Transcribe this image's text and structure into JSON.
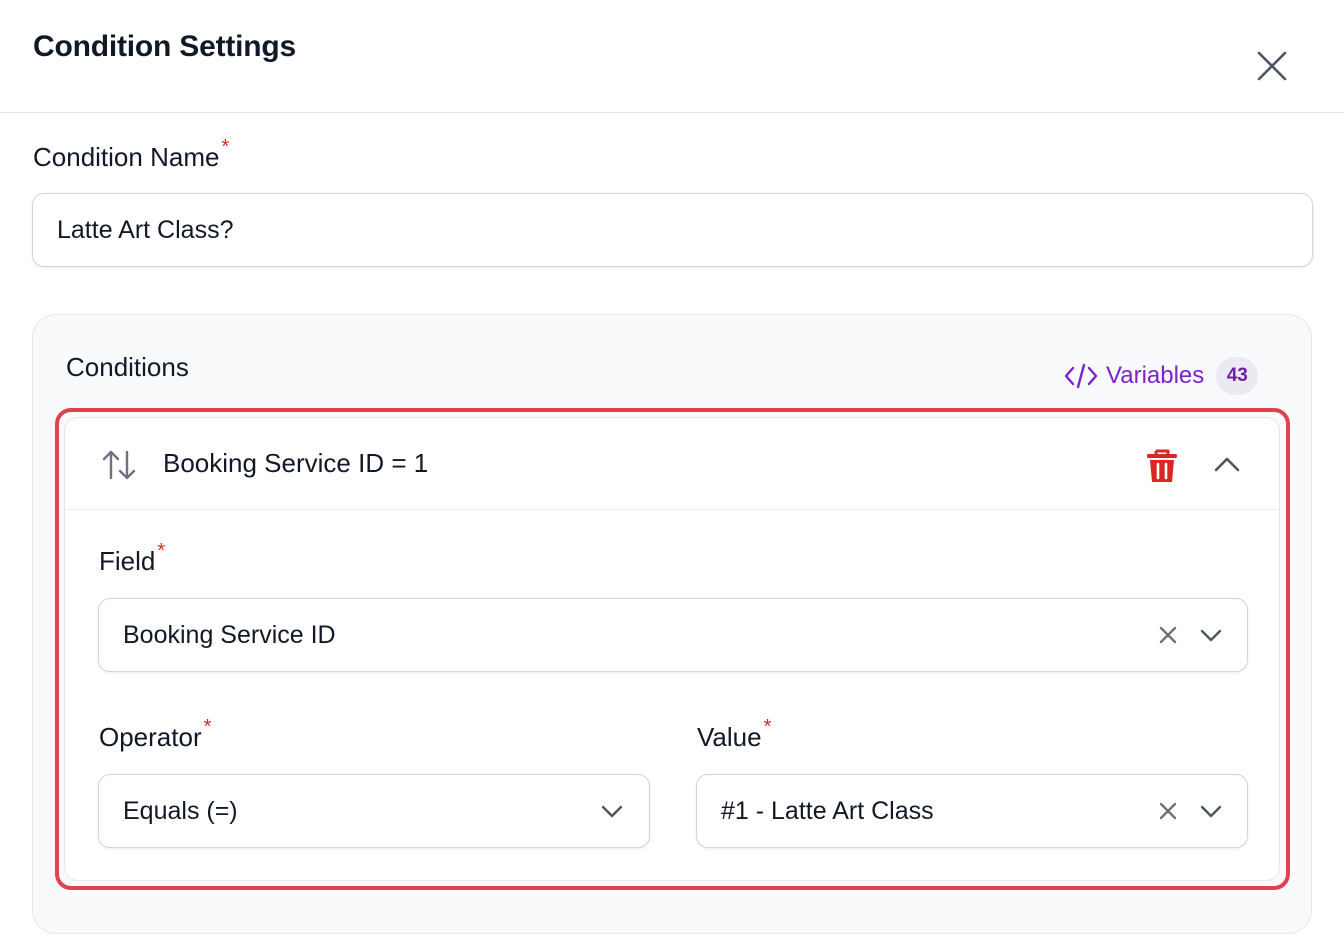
{
  "header": {
    "title": "Condition Settings",
    "close_icon": "close-icon"
  },
  "condition_name": {
    "label": "Condition Name",
    "required_mark": "*",
    "value": "Latte Art Class?"
  },
  "conditions": {
    "title": "Conditions",
    "variables_label": "Variables",
    "variables_count": "43",
    "variables_icon": "code-icon",
    "accent_color": "#7e22ce",
    "highlight_color": "#e0424f",
    "items": [
      {
        "summary": "Booking Service ID = 1",
        "field_label": "Field",
        "field_value": "Booking Service ID",
        "operator_label": "Operator",
        "operator_value": "Equals (=)",
        "value_label": "Value",
        "value_value": "#1 - Latte Art Class",
        "required_mark": "*"
      }
    ]
  }
}
